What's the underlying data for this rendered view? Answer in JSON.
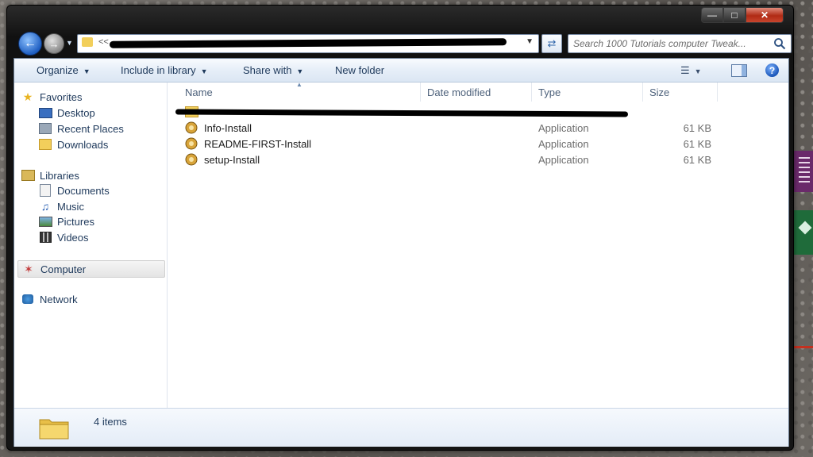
{
  "address": {
    "visible_fragment": "<<"
  },
  "search": {
    "placeholder": "Search 1000 Tutorials computer Tweak..."
  },
  "toolbar": {
    "organize": "Organize",
    "include_in_library": "Include in library",
    "share_with": "Share with",
    "new_folder": "New folder"
  },
  "sidebar": {
    "favorites": "Favorites",
    "favorites_items": [
      "Desktop",
      "Recent Places",
      "Downloads"
    ],
    "libraries": "Libraries",
    "libraries_items": [
      "Documents",
      "Music",
      "Pictures",
      "Videos"
    ],
    "computer": "Computer",
    "network": "Network"
  },
  "columns": {
    "name": "Name",
    "date": "Date modified",
    "type": "Type",
    "size": "Size"
  },
  "files": [
    {
      "name": "Info-Install",
      "type": "Application",
      "size": "61 KB"
    },
    {
      "name": "README-FIRST-Install",
      "type": "Application",
      "size": "61 KB"
    },
    {
      "name": "setup-Install",
      "type": "Application",
      "size": "61 KB"
    }
  ],
  "details": {
    "count": "4 items"
  },
  "colors": {
    "accent": "#1e395b",
    "titlebar": "#151515",
    "close": "#c9462e",
    "folder": "#f2cf5b"
  }
}
